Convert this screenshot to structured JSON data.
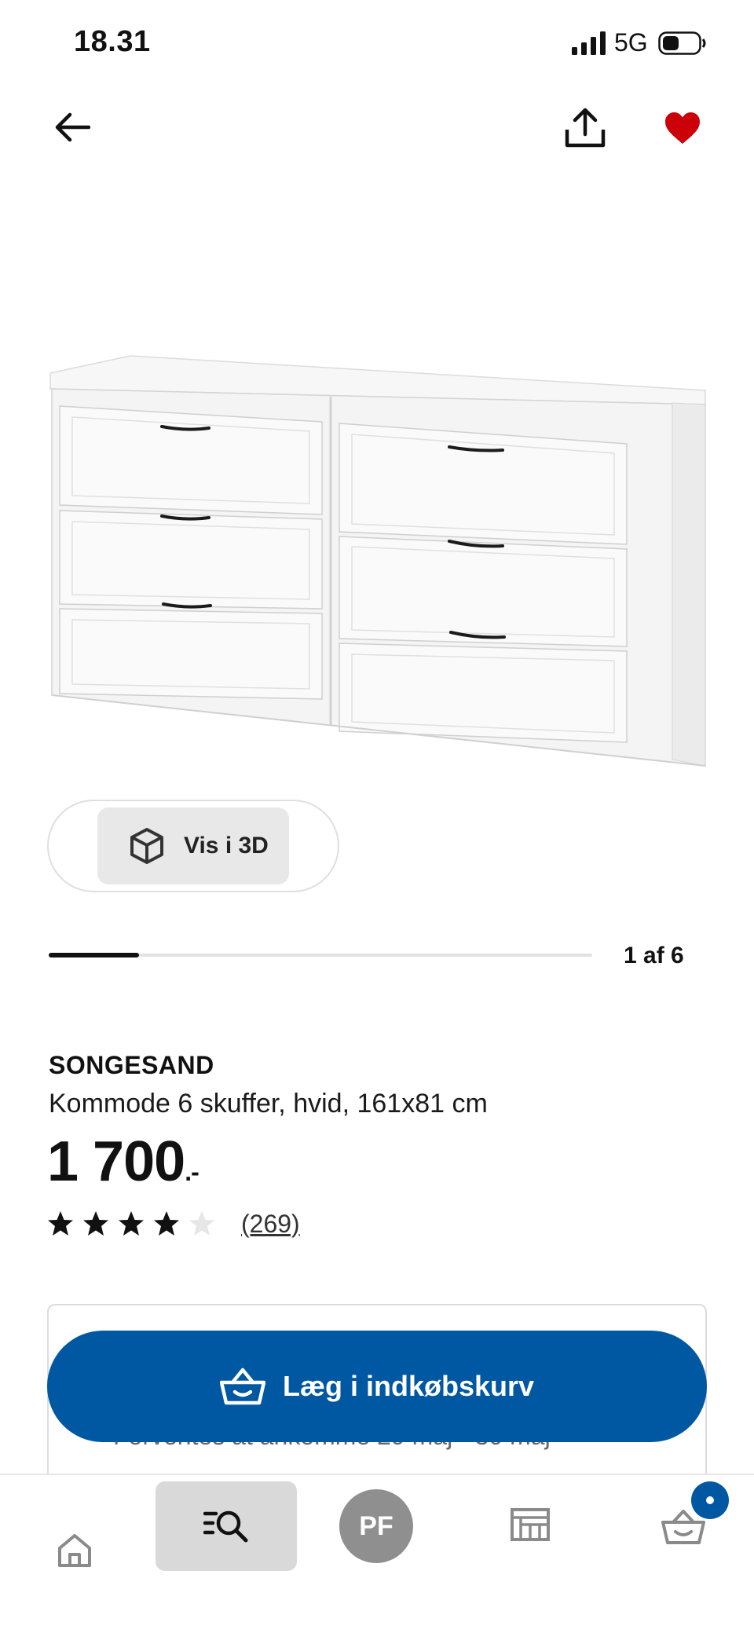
{
  "status_bar": {
    "time": "18.31",
    "network": "5G",
    "signal_icon": "cellular-signal-icon",
    "battery_icon": "battery-icon"
  },
  "top_nav": {
    "back_icon": "arrow-left-icon",
    "share_icon": "share-upload-icon",
    "favorite_icon": "heart-filled-icon",
    "favorite_active": true,
    "favorite_color": "#cc0008"
  },
  "gallery": {
    "image_description_icon": "dresser-product-image",
    "view_3d_label": "Vis i 3D",
    "view_3d_icon": "cube-3d-icon",
    "counter": "1 af 6",
    "current_index": 1,
    "total_images": 6
  },
  "product": {
    "name": "SONGESAND",
    "description": "Kommode 6 skuffer, hvid, 161x81 cm",
    "price": "1 700",
    "price_suffix": ".-",
    "rating_stars": 4,
    "rating_max": 5,
    "review_count": "(269)"
  },
  "delivery": {
    "text": "Forventes at ankomme 29 maj - 30 maj"
  },
  "add_to_cart": {
    "label": "Læg i indkøbskurv",
    "icon": "shopping-basket-icon",
    "color": "#0058a3"
  },
  "bottom_tabs": [
    {
      "icon": "home-icon"
    },
    {
      "icon": "search-list-icon",
      "active": true
    },
    {
      "label": "PF",
      "icon": "profile-avatar"
    },
    {
      "icon": "store-icon"
    },
    {
      "icon": "cart-basket-icon",
      "has_badge": true
    }
  ]
}
